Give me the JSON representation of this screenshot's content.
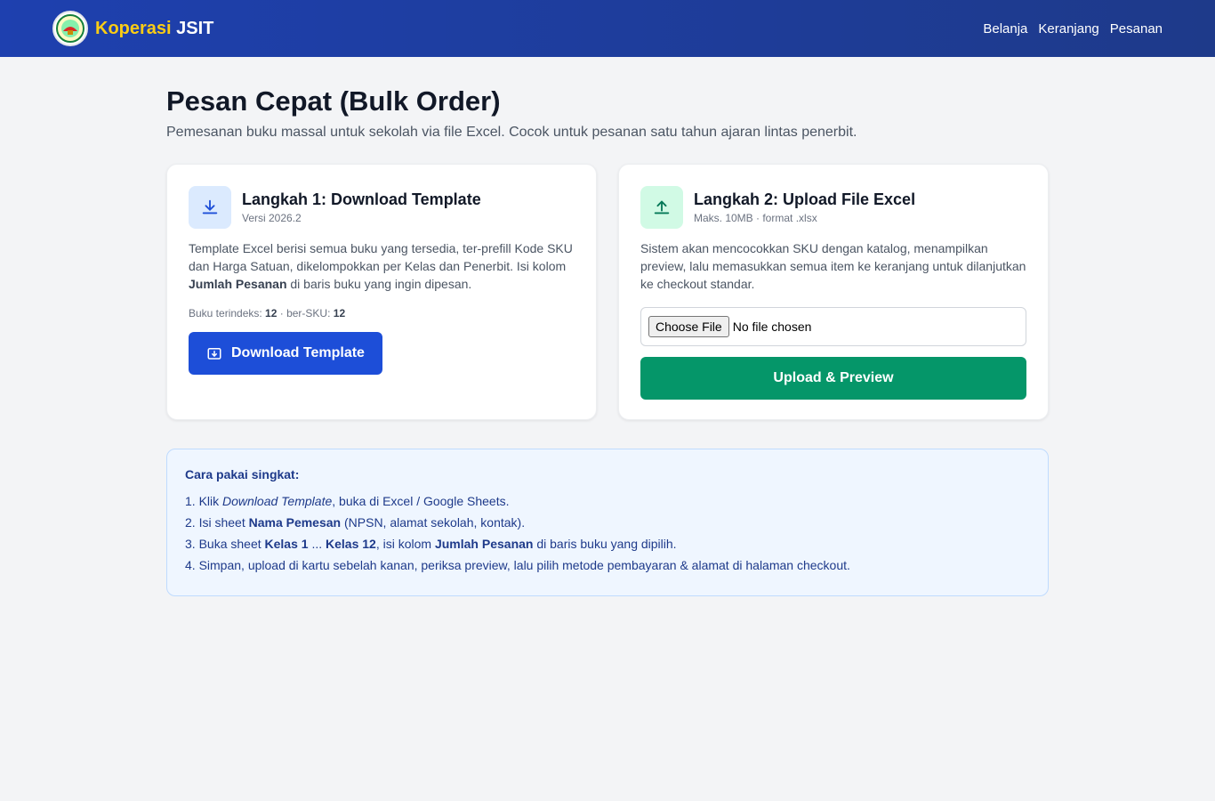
{
  "header": {
    "brand_part1": "Koperasi",
    "brand_part2": "JSIT",
    "nav": [
      "Belanja",
      "Keranjang",
      "Pesanan"
    ]
  },
  "page": {
    "title": "Pesan Cepat (Bulk Order)",
    "subtitle": "Pemesanan buku massal untuk sekolah via file Excel. Cocok untuk pesanan satu tahun ajaran lintas penerbit."
  },
  "step1": {
    "icon": "download-icon",
    "title": "Langkah 1: Download Template",
    "meta": "Versi 2026.2",
    "desc_1": "Template Excel berisi semua buku yang tersedia, ter-prefill Kode SKU dan Harga Satuan, dikelompokkan per Kelas dan Penerbit. Isi kolom ",
    "desc_bold": "Jumlah Pesanan",
    "desc_2": " di baris buku yang ingin dipesan.",
    "stat_label_1": "Buku terindeks: ",
    "stat_value_1": "12",
    "stat_label_2": " · ber-SKU: ",
    "stat_value_2": "12",
    "button_label": "Download Template"
  },
  "step2": {
    "icon": "upload-icon",
    "title": "Langkah 2: Upload File Excel",
    "meta": "Maks. 10MB · format .xlsx",
    "desc": "Sistem akan mencocokkan SKU dengan katalog, menampilkan preview, lalu memasukkan semua item ke keranjang untuk dilanjutkan ke checkout standar.",
    "file_button": "Choose File",
    "file_status": "No file chosen",
    "button_label": "Upload & Preview"
  },
  "howto": {
    "title": "Cara pakai singkat:",
    "s1_a": "1. Klik ",
    "s1_i": "Download Template",
    "s1_b": ", buka di Excel / Google Sheets.",
    "s2_a": "2. Isi sheet ",
    "s2_b1": "Nama Pemesan",
    "s2_b": " (NPSN, alamat sekolah, kontak).",
    "s3_a": "3. Buka sheet ",
    "s3_b1": "Kelas 1",
    "s3_mid": " ... ",
    "s3_b2": "Kelas 12",
    "s3_c": ", isi kolom ",
    "s3_b3": "Jumlah Pesanan",
    "s3_d": " di baris buku yang dipilih.",
    "s4": "4. Simpan, upload di kartu sebelah kanan, periksa preview, lalu pilih metode pembayaran & alamat di halaman checkout."
  },
  "colors": {
    "header": "#1e40af",
    "brand_accent": "#facc15",
    "primary": "#1d4ed8",
    "success": "#059669"
  }
}
